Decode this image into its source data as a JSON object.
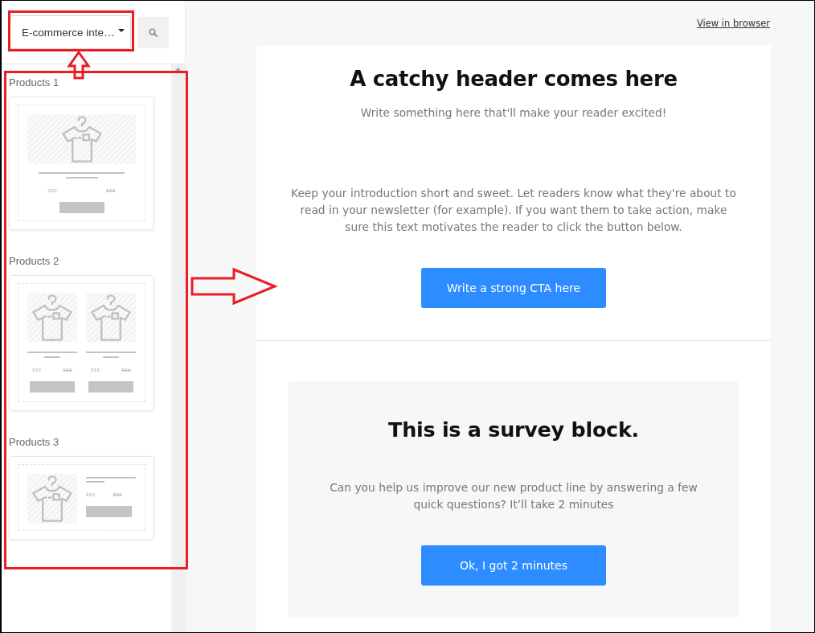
{
  "sidebar": {
    "dropdown": {
      "value": "E-commerce inte…"
    },
    "templates": [
      {
        "label": "Products 1",
        "kind": "stacked",
        "products": [
          {
            "price": "$$$",
            "old_price": "$$$"
          }
        ]
      },
      {
        "label": "Products 2",
        "kind": "grid",
        "products": [
          {
            "price": "$$$",
            "old_price": "$$$"
          },
          {
            "price": "$$$",
            "old_price": "$$$"
          }
        ]
      },
      {
        "label": "Products 3",
        "kind": "side",
        "products": [
          {
            "price": "$$$",
            "old_price": "$$$"
          }
        ]
      }
    ]
  },
  "main": {
    "view_link": "View in browser",
    "email": {
      "header": {
        "title": "A catchy header comes here",
        "subtitle": "Write something here that'll make your reader excited!"
      },
      "intro": "Keep your introduction short and sweet. Let readers know what they're about to read in your newsletter (for example). If you want them to take action, make sure this text motivates the reader to click the button below.",
      "cta": "Write a strong CTA here",
      "survey": {
        "title": "This is a survey block.",
        "text": "Can you help us improve our new product line by answering a few quick questions? It’ll take 2 minutes",
        "button": "Ok, I got 2 minutes"
      }
    }
  },
  "annotations": [
    {
      "kind": "frame"
    },
    {
      "kind": "arrow-up"
    },
    {
      "kind": "frame"
    },
    {
      "kind": "arrow-right"
    }
  ]
}
